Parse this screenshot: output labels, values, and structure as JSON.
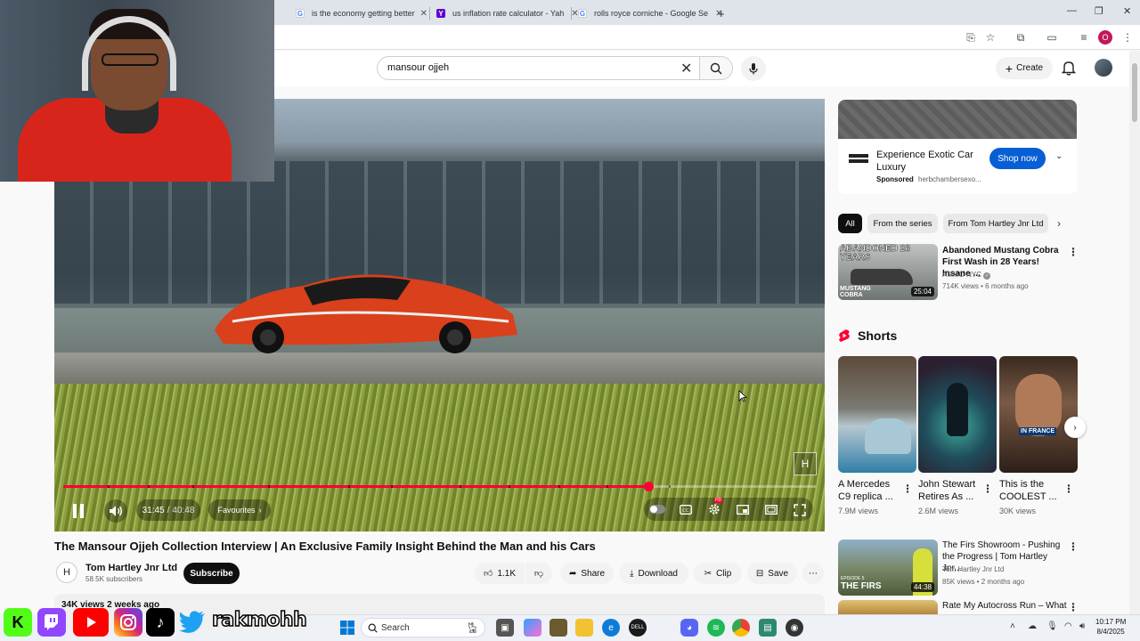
{
  "browser": {
    "tabs": [
      {
        "label": "is the economy getting better",
        "icon": "google-icon"
      },
      {
        "label": "us inflation rate calculator - Yah",
        "icon": "yahoo-icon"
      },
      {
        "label": "rolls royce corniche - Google Se",
        "icon": "google-icon"
      }
    ],
    "new_tab": "+",
    "profile_initial": "O"
  },
  "youtube": {
    "search": {
      "query": "mansour ojjeh"
    },
    "create_label": "Create"
  },
  "player": {
    "current_time": "31:45",
    "duration": "40:48",
    "progress_fraction": 0.778,
    "chapter_label": "Favourites",
    "hd_badge": "HD",
    "watermark": "H"
  },
  "video": {
    "title": "The Mansour Ojjeh Collection Interview | An Exclusive Family Insight Behind the Man and his Cars",
    "channel": {
      "name": "Tom Hartley Jnr Ltd",
      "subscribers": "58.5K subscribers",
      "avatar_text": "H"
    },
    "subscribe_label": "Subscribe",
    "likes": "1.1K",
    "share_label": "Share",
    "download_label": "Download",
    "clip_label": "Clip",
    "save_label": "Save",
    "meta": "34K views  2 weeks ago"
  },
  "sidebar": {
    "ad": {
      "title": "Experience Exotic Car Luxury",
      "sponsored": "Sponsored",
      "domain": "herbchambersexo...",
      "cta": "Shop now"
    },
    "chips": [
      "All",
      "From the series",
      "From Tom Hartley Jnr Ltd"
    ],
    "recommendations": [
      {
        "title": "Abandoned Mustang Cobra First Wash in 28 Years! Insane ...",
        "channel": "AMMO NYC",
        "views": "714K views • 6 months ago",
        "duration": "25:04",
        "thumb_text_top": "ABANDONED 28 YEARS",
        "thumb_text_bottom": "MUSTANG COBRA"
      },
      {
        "title": "The Firs Showroom - Pushing the Progress | Tom Hartley Jnr...",
        "channel": "Tom Hartley Jnr Ltd",
        "views": "85K views • 2 months ago",
        "duration": "44:38",
        "thumb_text": "THE FIRS",
        "thumb_small": "EPISODE 5"
      },
      {
        "title": "Rate My Autocross Run – What"
      }
    ],
    "shorts_heading": "Shorts",
    "shorts": [
      {
        "title": "A Mercedes C9 replica ...",
        "views": "7.9M views"
      },
      {
        "title": "John Stewart Retires As ...",
        "views": "2.6M views"
      },
      {
        "title": "This is the COOLEST ...",
        "views": "30K views",
        "overlay": "IN FRANCE"
      }
    ]
  },
  "overlay": {
    "handle": "rakmohh"
  },
  "taskbar": {
    "search_placeholder": "Search",
    "time": "10:17 PM",
    "date": "8/4/2025"
  }
}
